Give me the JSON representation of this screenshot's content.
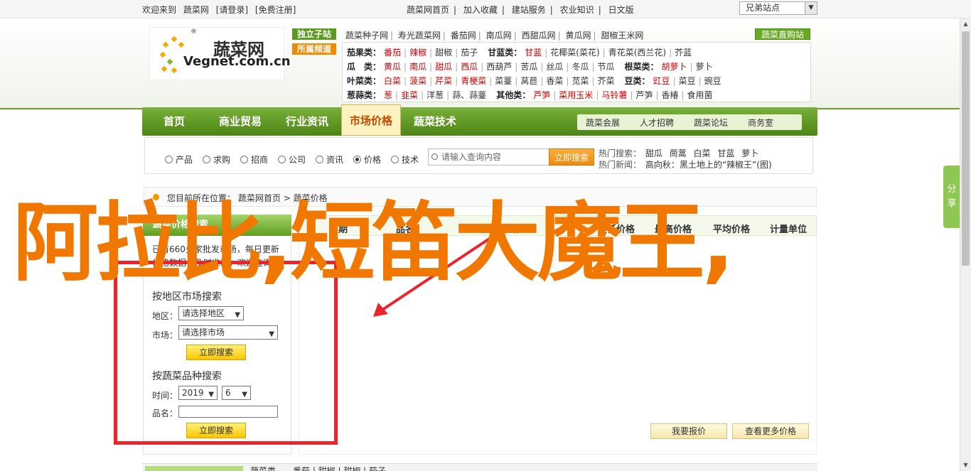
{
  "topbar": {
    "welcome_items": [
      "欢迎来到",
      "蔬菜网",
      "[请登录]",
      "[免费注册]"
    ],
    "links": [
      "蔬菜网首页",
      "|",
      "加入收藏",
      "|",
      "建站服务",
      "|",
      "农业知识",
      "|",
      "日文版"
    ],
    "select_value": "兄弟站点"
  },
  "logo": {
    "cn": "蔬菜网",
    "en": "Vegnet.com.cn",
    "reg": "®"
  },
  "tags": {
    "exclusive": "独立子站",
    "featured": "所属频道"
  },
  "hot_links": [
    "蔬菜种子网",
    "寿光蔬菜网",
    "番茄网",
    "南瓜网",
    "西甜瓜网",
    "黄瓜网",
    "甜椒王米网"
  ],
  "direct_button": "蔬菜直购站",
  "categories": [
    {
      "head": "茄果类：",
      "items": [
        {
          "t": "番茄",
          "red": true
        },
        {
          "t": "辣椒",
          "red": true
        },
        {
          "t": "甜椒"
        },
        {
          "t": "茄子"
        }
      ],
      "head2": "甘蓝类：",
      "items2": [
        {
          "t": "甘蓝",
          "red": true
        },
        {
          "t": "花椰菜(菜花)"
        },
        {
          "t": "青花菜(西兰花)"
        },
        {
          "t": "芥蓝"
        }
      ]
    },
    {
      "head": "瓜　类：",
      "items": [
        {
          "t": "黄瓜",
          "red": true
        },
        {
          "t": "南瓜",
          "red": true
        },
        {
          "t": "甜瓜",
          "red": true
        },
        {
          "t": "西瓜",
          "red": true
        },
        {
          "t": "西葫芦"
        },
        {
          "t": "苦瓜"
        },
        {
          "t": "丝瓜"
        },
        {
          "t": "冬瓜"
        },
        {
          "t": "节瓜"
        }
      ],
      "head2": "根菜类：",
      "items2": [
        {
          "t": "胡萝卜",
          "red": true
        },
        {
          "t": "萝卜"
        }
      ]
    },
    {
      "head": "叶菜类：",
      "items": [
        {
          "t": "白菜",
          "red": true
        },
        {
          "t": "菠菜",
          "red": true
        },
        {
          "t": "芹菜",
          "red": true
        },
        {
          "t": "青梗菜",
          "red": true
        },
        {
          "t": "菜薹"
        },
        {
          "t": "莴苣"
        },
        {
          "t": "香菜"
        },
        {
          "t": "苋菜"
        },
        {
          "t": "芥菜"
        }
      ],
      "head2": "豆类：",
      "items2": [
        {
          "t": "豇豆",
          "red": true
        },
        {
          "t": "菜豆"
        },
        {
          "t": "豌豆"
        }
      ]
    },
    {
      "head": "葱蒜类：",
      "items": [
        {
          "t": "葱",
          "red": true
        },
        {
          "t": "韭菜",
          "red": true
        },
        {
          "t": "洋葱"
        },
        {
          "t": "蒜、蒜薹"
        }
      ],
      "head2": "其他类：",
      "items2": [
        {
          "t": "芦笋",
          "red": true
        },
        {
          "t": "菜用玉米",
          "red": true
        },
        {
          "t": "马铃薯",
          "red": true
        },
        {
          "t": "芦笋"
        },
        {
          "t": "香椿"
        },
        {
          "t": "食用菌"
        }
      ]
    }
  ],
  "nav": {
    "items": [
      "首页",
      "商业贸易",
      "行业资讯",
      "市场价格",
      "蔬菜技术"
    ],
    "active_index": 3
  },
  "subnav": [
    "蔬菜会展",
    "人才招聘",
    "蔬菜论坛",
    "商务室"
  ],
  "search": {
    "radios": [
      "产品",
      "求购",
      "招商",
      "公司",
      "资讯",
      "价格",
      "技术"
    ],
    "checked_index": 5,
    "placeholder": "请输入查询内容",
    "button": "立即搜索",
    "hot_label": "热门搜索：",
    "hot_items": [
      "甜瓜",
      "茼蒿",
      "白菜",
      "甘蓝",
      "萝卜"
    ],
    "news_label": "热门新闻：",
    "news_text": "高向秋：黑土地上的“辣椒王”(图)"
  },
  "breadcrumb": {
    "label": "您目前所在位置：",
    "home": "蔬菜网首页",
    "sep": ">",
    "current": "蔬菜价格"
  },
  "left_panel": {
    "header": "蔬菜价格搜索",
    "desc": "已有660多家批发市场，每日更新价格数据，及时准确，欢迎查询！",
    "region_title": "按地区市场搜索",
    "region_label": "地区：",
    "region_value": "请选择地区",
    "market_label": "市场：",
    "market_value": "请选择市场",
    "search_button": "立即搜索",
    "variety_title": "按蔬菜品种搜索",
    "time_label": "时间：",
    "year_value": "2019",
    "month_value": "6",
    "name_label": "品名：",
    "search_button2": "立即搜索"
  },
  "table": {
    "headers": [
      "日期",
      "品名",
      "批发市场",
      "最低价格",
      "最高价格",
      "平均价格",
      "计量单位"
    ],
    "report_button": "我要报价",
    "more_button": "查看更多价格"
  },
  "bottom": {
    "text": "蔬菜类　　番茄 | 甜椒 | 甜椒 | 茄子"
  },
  "share": {
    "label": "分享"
  },
  "overlay": {
    "text": "阿拉比,短笛大魔王,"
  },
  "colors": {
    "brand_green": "#5b9a1e",
    "accent_orange": "#f08a00",
    "overlay_orange": "#f07800",
    "highlight_red": "#e8262e"
  }
}
